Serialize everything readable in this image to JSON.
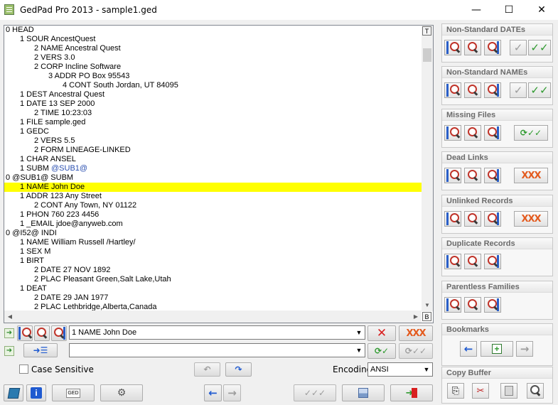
{
  "window": {
    "title": "GedPad Pro 2013 - sample1.ged",
    "minimize": "—",
    "maximize": "☐",
    "close": "✕"
  },
  "editor": {
    "corner_top": "T",
    "corner_bottom": "B",
    "lines": [
      {
        "indent": 0,
        "text": "0 HEAD"
      },
      {
        "indent": 1,
        "text": "1 SOUR AncestQuest"
      },
      {
        "indent": 2,
        "text": "2 NAME Ancestral Quest"
      },
      {
        "indent": 2,
        "text": "2 VERS 3.0"
      },
      {
        "indent": 2,
        "text": "2 CORP Incline Software"
      },
      {
        "indent": 3,
        "text": "3 ADDR PO Box 95543"
      },
      {
        "indent": 4,
        "text": "4 CONT South Jordan, UT 84095"
      },
      {
        "indent": 1,
        "text": "1 DEST Ancestral Quest"
      },
      {
        "indent": 1,
        "text": "1 DATE 13 SEP 2000"
      },
      {
        "indent": 2,
        "text": "2 TIME 10:23:03"
      },
      {
        "indent": 1,
        "text": "1 FILE sample.ged"
      },
      {
        "indent": 1,
        "text": "1 GEDC"
      },
      {
        "indent": 2,
        "text": "2 VERS 5.5"
      },
      {
        "indent": 2,
        "text": "2 FORM LINEAGE-LINKED"
      },
      {
        "indent": 1,
        "text": "1 CHAR ANSEL"
      },
      {
        "indent": 1,
        "text": "1 SUBM ",
        "pointer": "@SUB1@"
      },
      {
        "indent": 0,
        "text": "0 @SUB1@ SUBM"
      },
      {
        "indent": 1,
        "text": "1 NAME John Doe",
        "highlight": true
      },
      {
        "indent": 1,
        "text": "1 ADDR 123 Any Street"
      },
      {
        "indent": 2,
        "text": "2 CONT Any Town, NY 01122"
      },
      {
        "indent": 1,
        "text": "1 PHON 760 223 4456"
      },
      {
        "indent": 1,
        "text": "1 _EMAIL jdoe@anyweb.com"
      },
      {
        "indent": 0,
        "text": "0 @I52@ INDI"
      },
      {
        "indent": 1,
        "text": "1 NAME William Russell /Hartley/"
      },
      {
        "indent": 1,
        "text": "1 SEX M"
      },
      {
        "indent": 1,
        "text": "1 BIRT"
      },
      {
        "indent": 2,
        "text": "2 DATE 27 NOV 1892"
      },
      {
        "indent": 2,
        "text": "2 PLAC Pleasant Green,Salt Lake,Utah"
      },
      {
        "indent": 1,
        "text": "1 DEAT"
      },
      {
        "indent": 2,
        "text": "2 DATE 29 JAN 1977"
      },
      {
        "indent": 2,
        "text": "2 PLAC Lethbridge,Alberta,Canada"
      }
    ]
  },
  "search": {
    "find_value": "1 NAME John Doe",
    "replace_value": "",
    "case_sensitive_label": "Case Sensitive",
    "encoding_label": "Encoding:",
    "encoding_value": "ANSI",
    "xxx": "XXX"
  },
  "panels": {
    "nonstd_dates": "Non-Standard DATEs",
    "nonstd_names": "Non-Standard NAMEs",
    "missing_files": "Missing Files",
    "dead_links": "Dead Links",
    "unlinked_records": "Unlinked Records",
    "duplicate_records": "Duplicate Records",
    "parentless_families": "Parentless Families",
    "bookmarks": "Bookmarks",
    "copy_buffer": "Copy Buffer",
    "xxx": "XXX"
  },
  "bottom": {
    "ged_label": "GED"
  },
  "colors": {
    "highlight": "#ffff00",
    "pointer": "#2a4fb0",
    "accent_blue": "#1f5ad0",
    "accent_green": "#2f9a2f",
    "accent_orange": "#e35b1f"
  }
}
